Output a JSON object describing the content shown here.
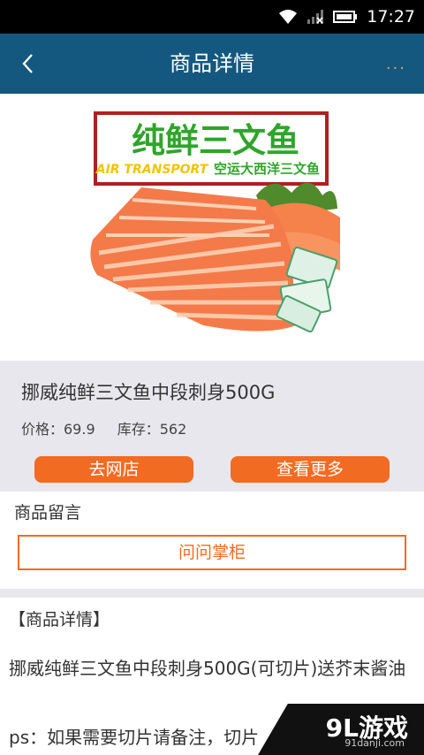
{
  "status": {
    "time": "17:27"
  },
  "app_bar": {
    "title": "商品详情",
    "more": "..."
  },
  "product": {
    "banner_title": "纯鲜三文鱼",
    "banner_sub_en": "AIR TRANSPORT",
    "banner_sub_cn": "空运大西洋三文鱼",
    "name": "挪威纯鲜三文鱼中段刺身500G",
    "price": "价格：69.9",
    "stock": "库存：562"
  },
  "actions": {
    "store": "去网店",
    "more": "查看更多"
  },
  "comments": {
    "title": "商品留言",
    "ask_button": "问问掌柜"
  },
  "detail": {
    "heading": "【商品详情】",
    "title": "挪威纯鲜三文鱼中段刺身500G(可切片)送芥末酱油",
    "ps": "ps：如果需要切片请备注，切片"
  },
  "watermark": {
    "logo": "9L游戏",
    "url": "91danji.com"
  },
  "colors": {
    "app_bar": "#14587f",
    "accent": "#f26b22",
    "banner_green": "#2fa52a"
  }
}
